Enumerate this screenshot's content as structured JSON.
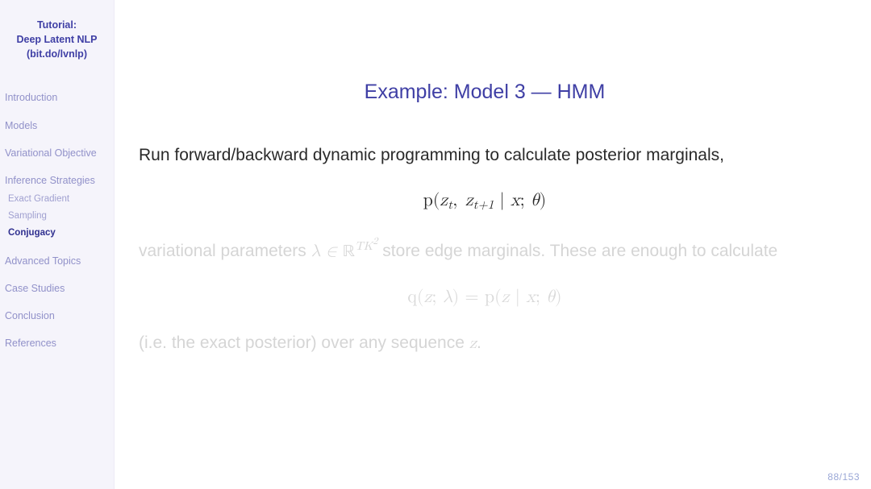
{
  "sidebar": {
    "title_line1": "Tutorial:",
    "title_line2": "Deep Latent NLP",
    "title_line3": "(bit.do/lvnlp)",
    "items": [
      {
        "label": "Introduction"
      },
      {
        "label": "Models"
      },
      {
        "label": "Variational Objective"
      },
      {
        "label": "Inference Strategies",
        "sub": [
          {
            "label": "Exact Gradient",
            "active": false
          },
          {
            "label": "Sampling",
            "active": false
          },
          {
            "label": "Conjugacy",
            "active": true
          }
        ]
      },
      {
        "label": "Advanced Topics"
      },
      {
        "label": "Case Studies"
      },
      {
        "label": "Conclusion"
      },
      {
        "label": "References"
      }
    ]
  },
  "slide": {
    "title": "Example: Model 3 — HMM",
    "body1": "Run forward/backward dynamic programming to calculate posterior marginals,",
    "math1_plain": "p(z_t, z_{t+1} | x; θ)",
    "faded_text_prefix": "variational parameters ",
    "faded_inline_math_plain": "λ ∈ ℝ^{TK^2}",
    "faded_text_mid": " store edge marginals. These are enough to calculate",
    "math2_plain": "q(z; λ) = p(z | x; θ)",
    "faded_text2_prefix": "(i.e. the exact posterior) over any sequence ",
    "faded_text2_var": "z",
    "faded_text2_suffix": "."
  },
  "page_counter": "88/153",
  "chart_data": {
    "type": "table",
    "note": "Presentation slide; no quantitative chart. Page 88 of 153."
  }
}
